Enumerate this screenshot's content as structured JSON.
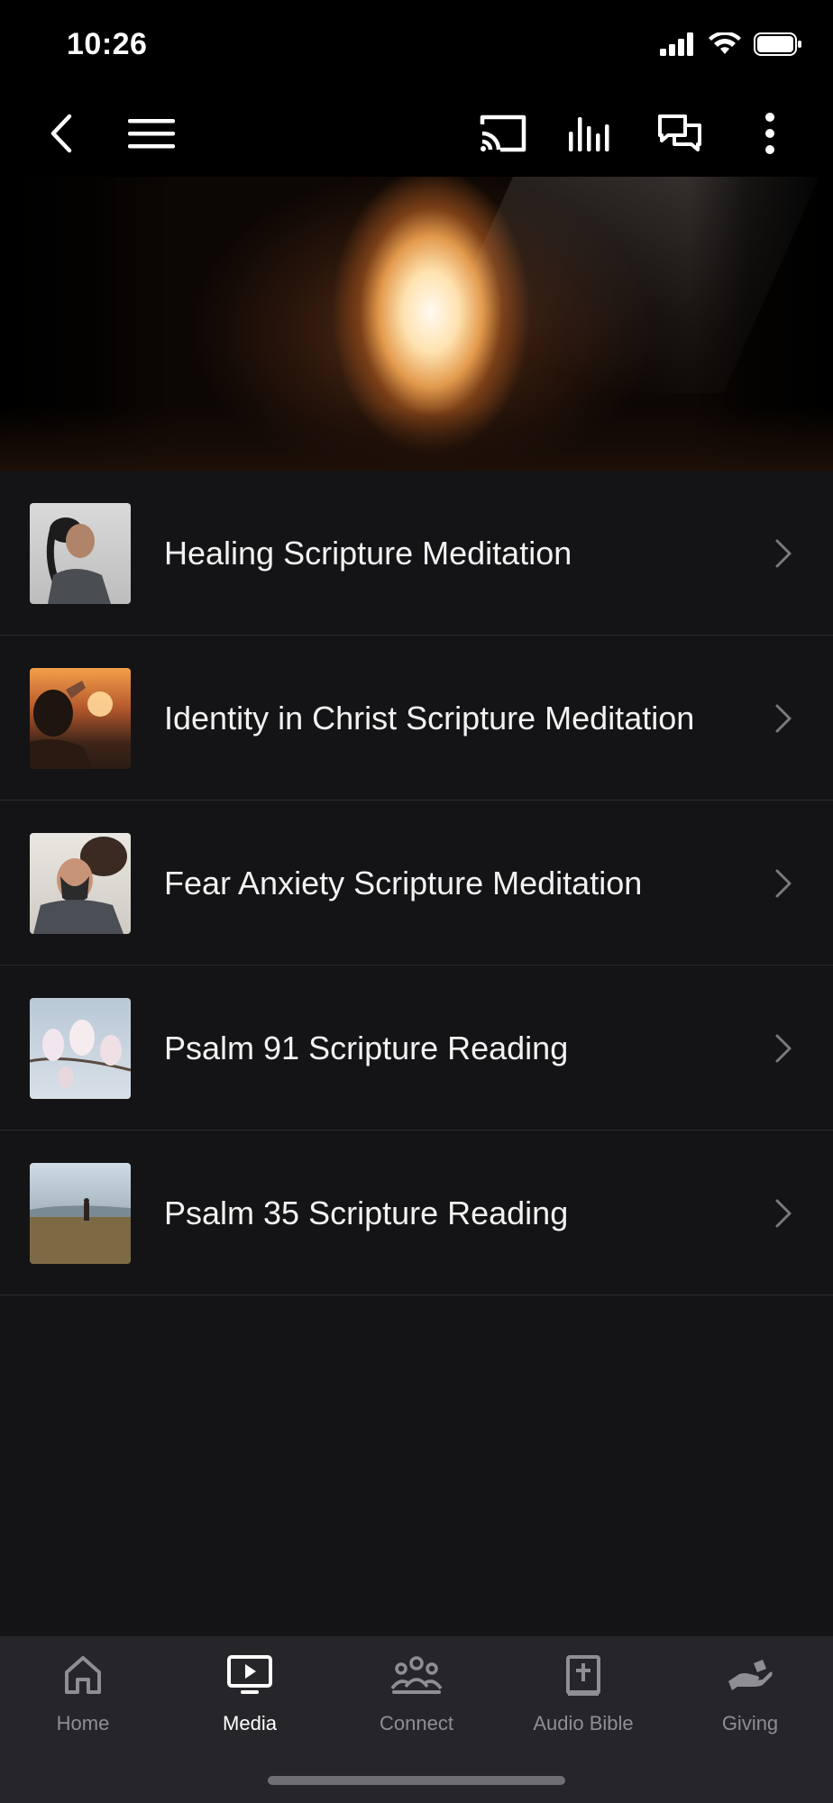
{
  "status_bar": {
    "time": "10:26"
  },
  "toolbar": {
    "icons": [
      "back-icon",
      "menu-icon",
      "cast-icon",
      "equalizer-icon",
      "chat-icon",
      "more-icon"
    ]
  },
  "hero": {
    "description_icon": "cave-light-image"
  },
  "list": {
    "items": [
      {
        "title": "Healing Scripture Meditation"
      },
      {
        "title": "Identity in Christ Scripture Meditation"
      },
      {
        "title": "Fear Anxiety Scripture Meditation"
      },
      {
        "title": "Psalm 91 Scripture Reading"
      },
      {
        "title": "Psalm 35 Scripture Reading"
      }
    ]
  },
  "tabbar": {
    "tabs": [
      {
        "label": "Home",
        "icon": "home-icon",
        "active": false
      },
      {
        "label": "Media",
        "icon": "media-icon",
        "active": true
      },
      {
        "label": "Connect",
        "icon": "connect-icon",
        "active": false
      },
      {
        "label": "Audio Bible",
        "icon": "audio-bible-icon",
        "active": false
      },
      {
        "label": "Giving",
        "icon": "giving-icon",
        "active": false
      }
    ]
  },
  "colors": {
    "background": "#141416",
    "toolbar": "#000000",
    "tabbar": "#26262a",
    "tab_inactive": "#8e8e93",
    "tab_active": "#ffffff"
  }
}
